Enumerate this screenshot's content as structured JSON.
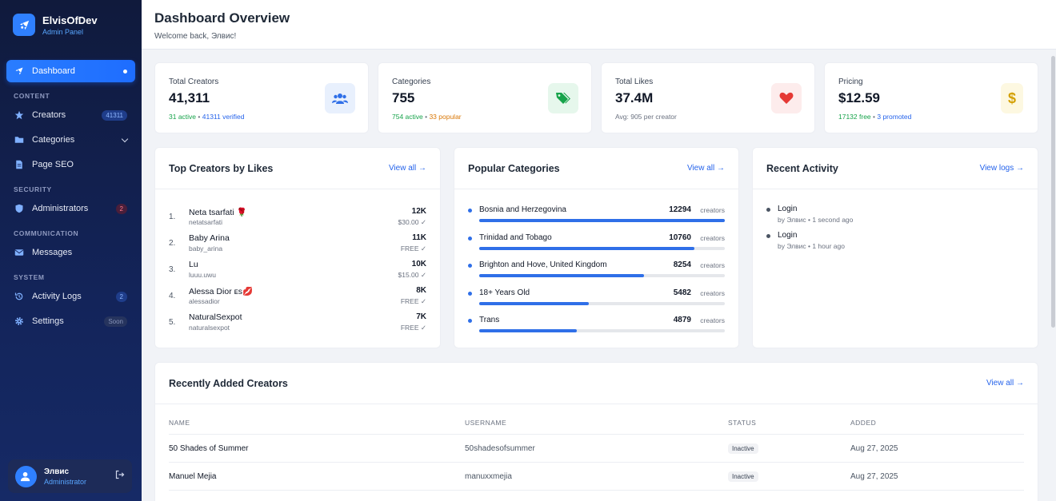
{
  "brand": {
    "name": "ElvisOfDev",
    "subtitle": "Admin Panel"
  },
  "sidebar": {
    "dashboard": "Dashboard",
    "sections": {
      "content": "CONTENT",
      "security": "SECURITY",
      "communication": "COMMUNICATION",
      "system": "SYSTEM"
    },
    "creators": {
      "label": "Creators",
      "badge": "41311"
    },
    "categories": {
      "label": "Categories"
    },
    "page_seo": {
      "label": "Page SEO"
    },
    "administrators": {
      "label": "Administrators",
      "badge": "2"
    },
    "messages": {
      "label": "Messages"
    },
    "activity_logs": {
      "label": "Activity Logs",
      "badge": "2"
    },
    "settings": {
      "label": "Settings",
      "badge": "Soon"
    }
  },
  "user": {
    "name": "Элвис",
    "role": "Administrator"
  },
  "header": {
    "title": "Dashboard Overview",
    "subtitle": "Welcome back, Элвис!"
  },
  "stats": {
    "creators": {
      "label": "Total Creators",
      "value": "41,311",
      "meta_a": "31 active",
      "sep": " • ",
      "meta_b": "41311 verified"
    },
    "categories": {
      "label": "Categories",
      "value": "755",
      "meta_a": "754 active",
      "sep": " • ",
      "meta_b": "33 popular"
    },
    "likes": {
      "label": "Total Likes",
      "value": "37.4M",
      "meta": "Avg: 905 per creator"
    },
    "pricing": {
      "label": "Pricing",
      "value": "$12.59",
      "meta_a": "17132 free",
      "sep": " • ",
      "meta_b": "3 promoted",
      "icon_glyph": "$"
    }
  },
  "top_creators": {
    "title": "Top Creators by Likes",
    "view_all": "View all →",
    "rows": [
      {
        "rank": "1.",
        "name": "Neta tsarfati 🌹",
        "username": "netatsarfati",
        "likes": "12K",
        "price": "$30.00 ✓"
      },
      {
        "rank": "2.",
        "name": "Baby Arina",
        "username": "baby_arina",
        "likes": "11K",
        "price": "FREE ✓"
      },
      {
        "rank": "3.",
        "name": "Lu",
        "username": "luuu.uwu",
        "likes": "10K",
        "price": "$15.00 ✓"
      },
      {
        "rank": "4.",
        "name": "Alessa Dior ᴇs💋",
        "username": "alessadior",
        "likes": "8K",
        "price": "FREE ✓"
      },
      {
        "rank": "5.",
        "name": "NaturalSexpot",
        "username": "naturalsexpot",
        "likes": "7K",
        "price": "FREE ✓"
      }
    ]
  },
  "popular_categories": {
    "title": "Popular Categories",
    "view_all": "View all →",
    "rows": [
      {
        "name": "Bosnia and Herzegovina",
        "count": "12294",
        "unit": "creators",
        "fill": 1.0
      },
      {
        "name": "Trinidad and Tobago",
        "count": "10760",
        "unit": "creators",
        "fill": 0.875
      },
      {
        "name": "Brighton and Hove, United Kingdom",
        "count": "8254",
        "unit": "creators",
        "fill": 0.671
      },
      {
        "name": "18+ Years Old",
        "count": "5482",
        "unit": "creators",
        "fill": 0.446
      },
      {
        "name": "Trans",
        "count": "4879",
        "unit": "creators",
        "fill": 0.397
      }
    ]
  },
  "recent_activity": {
    "title": "Recent Activity",
    "view_logs": "View logs →",
    "rows": [
      {
        "action": "Login",
        "meta": "by Элвис • 1 second ago"
      },
      {
        "action": "Login",
        "meta": "by Элвис • 1 hour ago"
      }
    ]
  },
  "recent_creators": {
    "title": "Recently Added Creators",
    "view_all": "View all →",
    "columns": {
      "name": "NAME",
      "username": "USERNAME",
      "status": "STATUS",
      "added": "ADDED"
    },
    "rows": [
      {
        "name": "50 Shades of Summer",
        "username": "50shadesofsummer",
        "status": "Inactive",
        "added": "Aug 27, 2025"
      },
      {
        "name": "Manuel Mejia",
        "username": "manuxxmejia",
        "status": "Inactive",
        "added": "Aug 27, 2025"
      }
    ]
  },
  "colors": {
    "accent": "#2f80ff",
    "sidebar_bg": "#101a3c",
    "bar": "#2f6fe8"
  }
}
